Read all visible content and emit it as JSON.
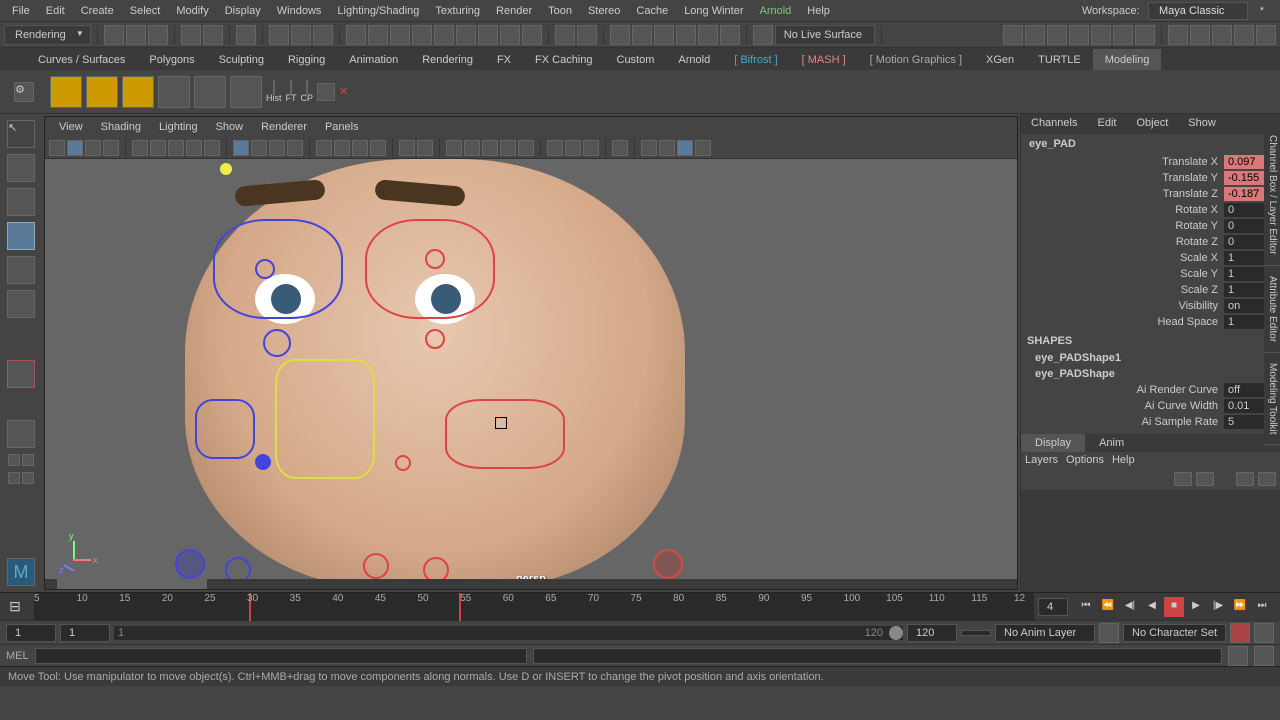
{
  "menubar": [
    "File",
    "Edit",
    "Create",
    "Select",
    "Modify",
    "Display",
    "Windows",
    "Lighting/Shading",
    "Texturing",
    "Render",
    "Toon",
    "Stereo",
    "Cache",
    "Long Winter"
  ],
  "arnold": "Arnold",
  "help": "Help",
  "workspace_label": "Workspace:",
  "workspace_value": "Maya Classic",
  "mode_dropdown": "Rendering",
  "live_surface": "No Live Surface",
  "shelf_tabs": [
    "Curves / Surfaces",
    "Polygons",
    "Sculpting",
    "Rigging",
    "Animation",
    "Rendering",
    "FX",
    "FX Caching",
    "Custom",
    "Arnold"
  ],
  "shelf_special": {
    "bifrost": "Bifrost",
    "mash": "MASH",
    "mgfx": "Motion Graphics"
  },
  "shelf_tabs2": [
    "XGen",
    "TURTLE",
    "Modeling"
  ],
  "shelf_labels": {
    "hist": "Hist",
    "ft": "FT",
    "cp": "CP"
  },
  "viewport_menus": [
    "View",
    "Shading",
    "Lighting",
    "Show",
    "Renderer",
    "Panels"
  ],
  "persp": "persp",
  "axis": {
    "x": "x",
    "y": "y",
    "z": "z"
  },
  "channel_tabs": [
    "Channels",
    "Edit",
    "Object",
    "Show"
  ],
  "selected_object": "eye_PAD",
  "channels": [
    {
      "label": "Translate X",
      "value": "0.097",
      "hl": true
    },
    {
      "label": "Translate Y",
      "value": "-0.155",
      "hl": true
    },
    {
      "label": "Translate Z",
      "value": "-0.187",
      "hl": true
    },
    {
      "label": "Rotate X",
      "value": "0",
      "hl": false
    },
    {
      "label": "Rotate Y",
      "value": "0",
      "hl": false
    },
    {
      "label": "Rotate Z",
      "value": "0",
      "hl": false
    },
    {
      "label": "Scale X",
      "value": "1",
      "hl": false
    },
    {
      "label": "Scale Y",
      "value": "1",
      "hl": false
    },
    {
      "label": "Scale Z",
      "value": "1",
      "hl": false
    },
    {
      "label": "Visibility",
      "value": "on",
      "hl": false
    },
    {
      "label": "Head Space",
      "value": "1",
      "hl": false
    }
  ],
  "shapes_header": "SHAPES",
  "shapes": [
    "eye_PADShape1",
    "eye_PADShape"
  ],
  "shape_attrs": [
    {
      "label": "Ai Render Curve",
      "value": "off"
    },
    {
      "label": "Ai Curve Width",
      "value": "0.01"
    },
    {
      "label": "Ai Sample Rate",
      "value": "5"
    }
  ],
  "display_anim": {
    "display": "Display",
    "anim": "Anim"
  },
  "layer_menu": [
    "Layers",
    "Options",
    "Help"
  ],
  "side_tabs": [
    "Channel Box / Layer Editor",
    "Attribute Editor",
    "Modeling Toolkit"
  ],
  "time_ticks": [
    5,
    10,
    15,
    20,
    25,
    30,
    35,
    40,
    45,
    50,
    55,
    60,
    65,
    70,
    75,
    80,
    85,
    90,
    95,
    100,
    105,
    110,
    115,
    12
  ],
  "current_frame": "4",
  "range": {
    "start": "1",
    "start2": "1",
    "start3": "1",
    "end": "120",
    "end2": "120"
  },
  "anim_layer": "No Anim Layer",
  "char_set": "No Character Set",
  "cmd_label": "MEL",
  "help_line": "Move Tool: Use manipulator to move object(s). Ctrl+MMB+drag to move components along normals. Use D or INSERT to change the pivot position and axis orientation."
}
